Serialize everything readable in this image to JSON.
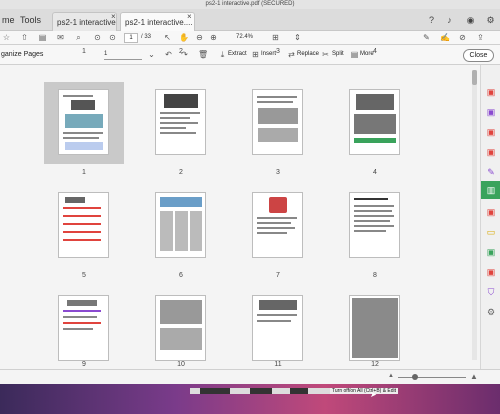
{
  "window": {
    "title": "ps2-1 interactive.pdf (SECURED)"
  },
  "tabs": {
    "home": "me",
    "tools": "Tools",
    "items": [
      {
        "label": "ps2-1 interactive t..."
      },
      {
        "label": "ps2-1 interactive...."
      }
    ],
    "close": "×"
  },
  "toolbar": {
    "page_current": "1",
    "page_total": "/ 33",
    "zoom": "72.4%"
  },
  "organize": {
    "title": "ganize Pages",
    "range_value": "1",
    "buttons": {
      "extract": "Extract",
      "insert": "Insert",
      "replace": "Replace",
      "split": "Split",
      "more": "More"
    },
    "close_label": "Close"
  },
  "thumbnails": [
    {
      "label": "1",
      "selected": true
    },
    {
      "label": "2"
    },
    {
      "label": "3"
    },
    {
      "label": "4"
    },
    {
      "label": "5"
    },
    {
      "label": "6"
    },
    {
      "label": "7"
    },
    {
      "label": "8"
    },
    {
      "label": "9"
    },
    {
      "label": "10"
    },
    {
      "label": "11"
    },
    {
      "label": "12"
    }
  ],
  "dock": {
    "caption": "Turn off/on All (Ctrl+B) & Edit"
  },
  "icons": {
    "print": "printer-icon",
    "bookmark": "bookmark-icon",
    "search": "search-icon",
    "colors": {
      "accent_green": "#3aa35c",
      "accent_red": "#e0443e",
      "accent_purple": "#8a4ad0"
    }
  }
}
